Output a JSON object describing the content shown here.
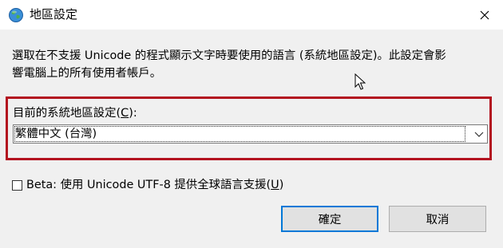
{
  "window": {
    "title": "地區設定",
    "icon": "globe-icon"
  },
  "description": "選取在不支援 Unicode 的程式顯示文字時要使用的語言 (系統地區設定)。此設定會影\n響電腦上的所有使用者帳戶。",
  "locale": {
    "label_prefix": "目前的系統地區設定(",
    "label_access_key": "C",
    "label_suffix": "):",
    "selected_value": "繁體中文 (台灣)"
  },
  "beta_option": {
    "label_prefix": "Beta: 使用 Unicode UTF-8 提供全球語言支援(",
    "label_access_key": "U",
    "label_suffix": ")",
    "checked": false
  },
  "buttons": {
    "ok_label": "確定",
    "cancel_label": "取消"
  },
  "colors": {
    "highlight_border": "#b3121f",
    "default_button_border": "#0078d7"
  }
}
